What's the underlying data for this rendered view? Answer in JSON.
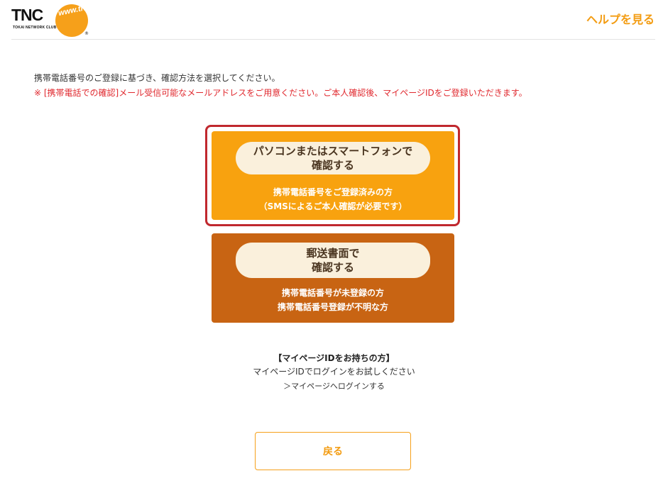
{
  "header": {
    "logo": {
      "name": "TNC",
      "tagline": "TOKAI NETWORK CLUB",
      "url": "www.tnc.ne.jp"
    },
    "help_link": "ヘルプを見る"
  },
  "intro": {
    "text": "携帯電話番号のご登録に基づき、確認方法を選択してください。",
    "notice": "※ [携帯電話での確認]メール受信可能なメールアドレスをご用意ください。ご本人確認後、マイページIDをご登録いただきます。"
  },
  "options": [
    {
      "title_line1": "パソコンまたはスマートフォンで",
      "title_line2": "確認する",
      "desc_line1": "携帯電話番号をご登録済みの方",
      "desc_line2": "（SMSによるご本人確認が必要です）"
    },
    {
      "title_line1": "郵送書面で",
      "title_line2": "確認する",
      "desc_line1": "携帯電話番号が未登録の方",
      "desc_line2": "携帯電話番号登録が不明な方"
    }
  ],
  "mypage": {
    "title": "【マイページIDをお持ちの方】",
    "text": "マイページIDでログインをお試しください",
    "link": "＞マイページへログインする"
  },
  "back_button": "戻る",
  "colors": {
    "accent": "#f39c12",
    "card_primary": "#f8a20f",
    "card_secondary": "#c86413",
    "highlight": "#c0282e",
    "notice": "#e0282e"
  }
}
